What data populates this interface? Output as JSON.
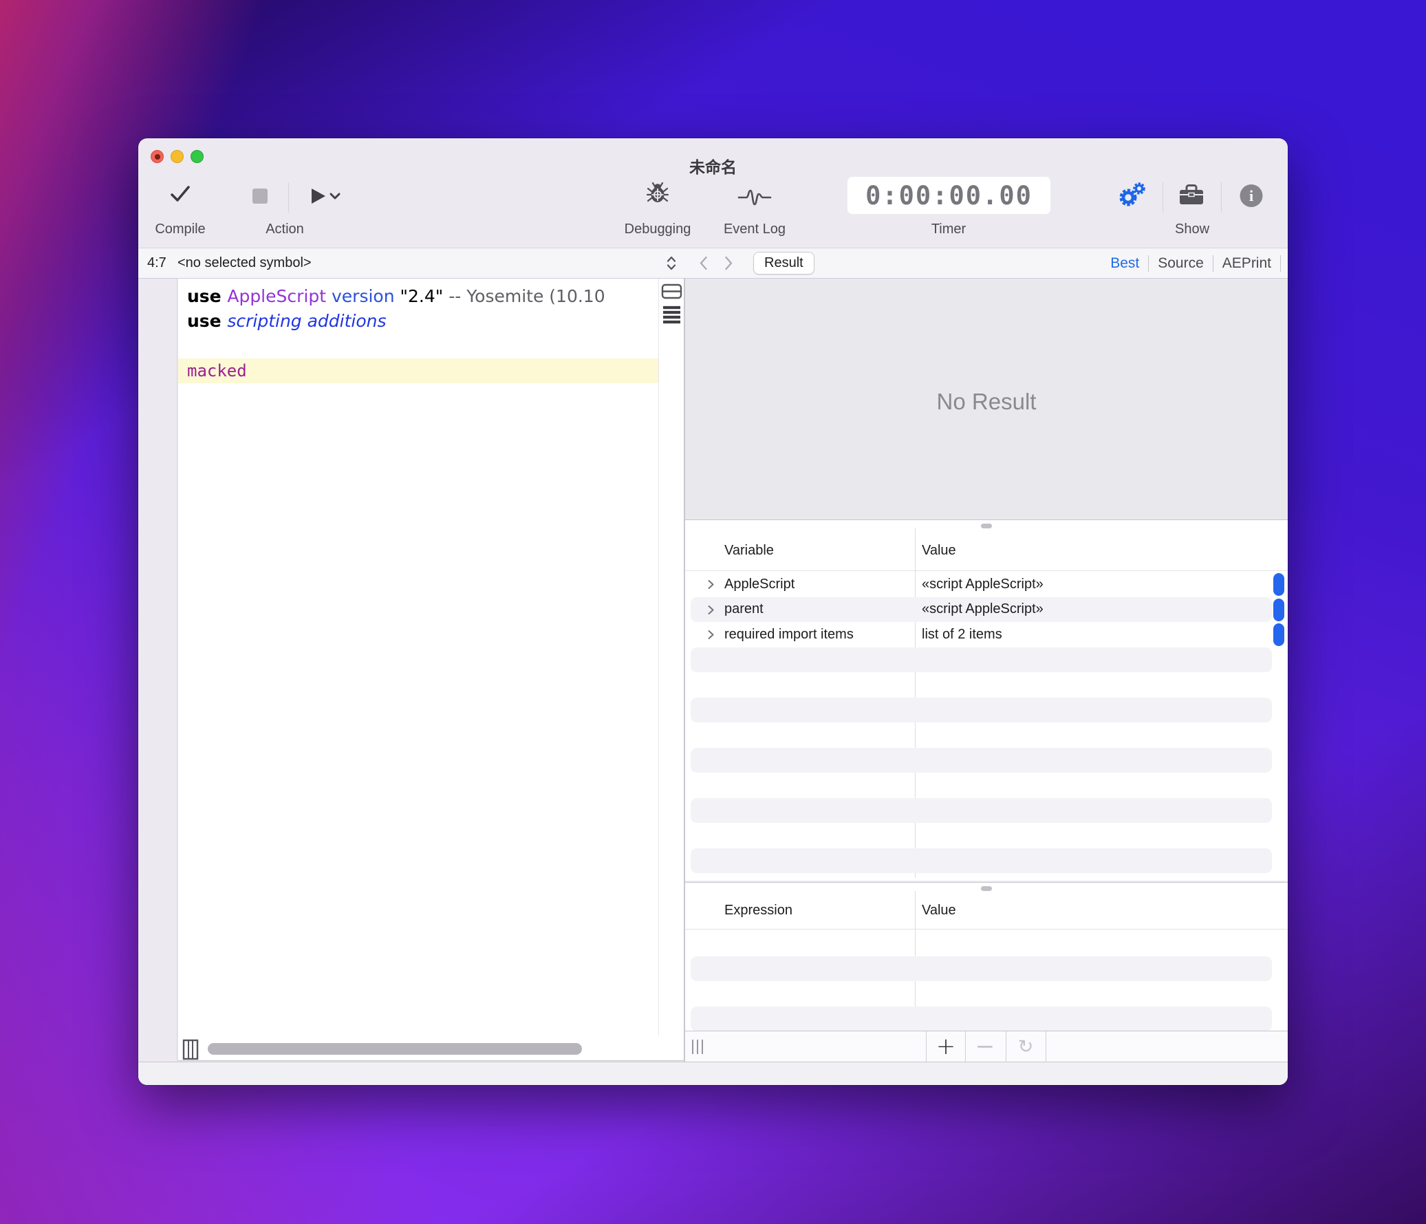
{
  "window": {
    "title": "未命名"
  },
  "toolbar": {
    "compile": {
      "label": "Compile"
    },
    "action": {
      "label": "Action"
    },
    "debugging": {
      "label": "Debugging"
    },
    "event_log": {
      "label": "Event Log"
    },
    "timer": {
      "label": "Timer",
      "value": "0:00:00.00"
    },
    "show": {
      "label": "Show"
    }
  },
  "navbar": {
    "cursor_position": "4:7",
    "selected_symbol": "<no selected symbol>",
    "result_button": "Result",
    "view_modes": [
      {
        "label": "Best",
        "active": true
      },
      {
        "label": "Source",
        "active": false
      },
      {
        "label": "AEPrint",
        "active": false
      }
    ]
  },
  "editor": {
    "lines": [
      {
        "highlight": false,
        "segments": [
          {
            "text": "use ",
            "style": "keyword"
          },
          {
            "text": "AppleScript",
            "style": "class"
          },
          {
            "text": " ",
            "style": "literal"
          },
          {
            "text": "version",
            "style": "command"
          },
          {
            "text": " \"2.4\"",
            "style": "literal"
          },
          {
            "text": " -- Yosemite (10.10",
            "style": "comment"
          }
        ]
      },
      {
        "highlight": false,
        "segments": [
          {
            "text": "use ",
            "style": "keyword"
          },
          {
            "text": "scripting additions",
            "style": "language"
          }
        ]
      },
      {
        "highlight": false,
        "segments": []
      },
      {
        "highlight": true,
        "segments": [
          {
            "text": "macked",
            "style": "uncompiled"
          }
        ]
      }
    ]
  },
  "result_pane": {
    "empty_text": "No Result"
  },
  "variables_pane": {
    "columns": [
      "Variable",
      "Value"
    ],
    "rows": [
      {
        "name": "AppleScript",
        "value": "«script AppleScript»"
      },
      {
        "name": "parent",
        "value": "«script AppleScript»"
      },
      {
        "name": "required import items",
        "value": "list of 2 items"
      }
    ]
  },
  "expressions_pane": {
    "columns": [
      "Expression",
      "Value"
    ],
    "rows": []
  },
  "colors": {
    "accent_blue": "#2566ee",
    "highlight_yellow": "#fcf9d4",
    "uncompiled_magenta": "#9b2190",
    "class_purple": "#9333d6",
    "command_blue": "#2b50d9",
    "language_blue": "#1f36e0",
    "comment_gray": "#5f5e63"
  }
}
